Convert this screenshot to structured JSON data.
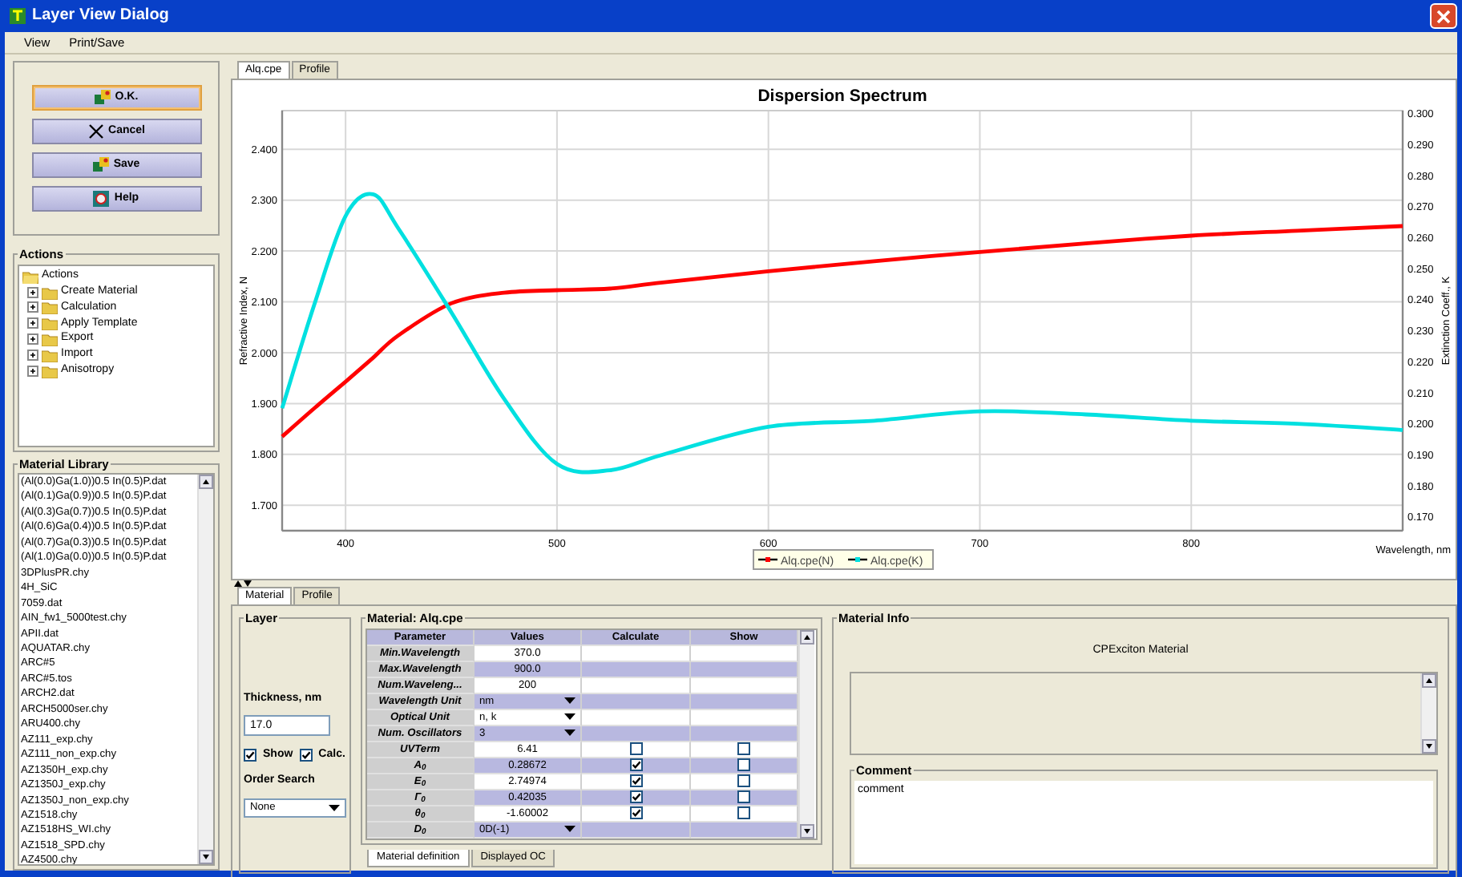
{
  "window": {
    "title": "Layer View Dialog"
  },
  "menu": [
    "View",
    "Print/Save"
  ],
  "buttons": [
    {
      "label": "O.K.",
      "kind": "ok",
      "focused": true
    },
    {
      "label": "Cancel",
      "kind": "cancel",
      "focused": false
    },
    {
      "label": "Save",
      "kind": "save",
      "focused": false
    },
    {
      "label": "Help",
      "kind": "help",
      "focused": false
    }
  ],
  "actions": {
    "title": "Actions",
    "root": "Actions",
    "items": [
      {
        "label": "Create Material",
        "expanded": false
      },
      {
        "label": "Calculation",
        "expanded": false
      },
      {
        "label": "Apply Template",
        "expanded": false
      },
      {
        "label": "Export",
        "expanded": false
      },
      {
        "label": "Import",
        "expanded": false
      },
      {
        "label": "Anisotropy",
        "expanded": false
      }
    ]
  },
  "material_library": {
    "title": "Material Library",
    "items": [
      "(Al(0.0)Ga(1.0))0.5 In(0.5)P.dat",
      "(Al(0.1)Ga(0.9))0.5 In(0.5)P.dat",
      "(Al(0.3)Ga(0.7))0.5 In(0.5)P.dat",
      "(Al(0.6)Ga(0.4))0.5 In(0.5)P.dat",
      "(Al(0.7)Ga(0.3))0.5 In(0.5)P.dat",
      "(Al(1.0)Ga(0.0))0.5 In(0.5)P.dat",
      "3DPlusPR.chy",
      "4H_SiC",
      "7059.dat",
      "AIN_fw1_5000test.chy",
      "APII.dat",
      "AQUATAR.chy",
      "ARC#5",
      "ARC#5.tos",
      "ARCH2.dat",
      "ARCH5000ser.chy",
      "ARU400.chy",
      "AZ111_exp.chy",
      "AZ111_non_exp.chy",
      "AZ1350H_exp.chy",
      "AZ1350J_exp.chy",
      "AZ1350J_non_exp.chy",
      "AZ1518.chy",
      "AZ1518HS_WI.chy",
      "AZ1518_SPD.chy",
      "AZ4500.chy"
    ]
  },
  "chart_tabs": [
    {
      "label": "Alq.cpe",
      "selected": true
    },
    {
      "label": "Profile",
      "selected": false
    }
  ],
  "chart": {
    "chart_data": {
      "type": "line",
      "title": "Dispersion Spectrum",
      "xlabel": "Wavelength, nm",
      "ylabel": "Refractive Index, N",
      "y2label": "Extinction Coeff., K",
      "x": [
        370,
        385,
        400,
        413,
        425,
        450,
        475,
        500,
        525,
        550,
        600,
        650,
        700,
        750,
        800,
        850,
        900
      ],
      "series": [
        {
          "name": "Alq.cpe(N)",
          "color": "#ff0000",
          "values": [
            1.835,
            1.89,
            1.943,
            1.99,
            2.034,
            2.097,
            2.118,
            2.123,
            2.126,
            2.138,
            2.16,
            2.18,
            2.198,
            2.215,
            2.23,
            2.24,
            2.249
          ]
        },
        {
          "name": "Alq.cpe(K)",
          "color": "#00e0e0",
          "axis": "y2",
          "values": [
            0.205,
            0.238,
            0.267,
            0.274,
            0.263,
            0.236,
            0.208,
            0.187,
            0.185,
            0.19,
            0.199,
            0.201,
            0.204,
            0.203,
            0.201,
            0.2,
            0.198
          ]
        }
      ],
      "grid": true,
      "legend": "bottom",
      "xlim": [
        370,
        900
      ],
      "ylim": [
        1.65,
        2.476
      ],
      "y2lim": [
        0.1655,
        0.301
      ],
      "xticks": [
        400,
        500,
        600,
        700,
        800
      ],
      "yticks": [
        {
          "value": 1.7,
          "label": "1.700"
        },
        {
          "value": 1.8,
          "label": "1.800"
        },
        {
          "value": 1.9,
          "label": "1.900"
        },
        {
          "value": 2.0,
          "label": "2.000"
        },
        {
          "value": 2.1,
          "label": "2.100"
        },
        {
          "value": 2.2,
          "label": "2.200"
        },
        {
          "value": 2.3,
          "label": "2.300"
        },
        {
          "value": 2.4,
          "label": "2.400"
        }
      ],
      "y2ticks": [
        {
          "value": 0.17,
          "label": "0.170"
        },
        {
          "value": 0.18,
          "label": "0.180"
        },
        {
          "value": 0.19,
          "label": "0.190"
        },
        {
          "value": 0.2,
          "label": "0.200"
        },
        {
          "value": 0.21,
          "label": "0.210"
        },
        {
          "value": 0.22,
          "label": "0.220"
        },
        {
          "value": 0.23,
          "label": "0.230"
        },
        {
          "value": 0.24,
          "label": "0.240"
        },
        {
          "value": 0.25,
          "label": "0.250"
        },
        {
          "value": 0.26,
          "label": "0.260"
        },
        {
          "value": 0.27,
          "label": "0.270"
        },
        {
          "value": 0.28,
          "label": "0.280"
        },
        {
          "value": 0.29,
          "label": "0.290"
        },
        {
          "value": 0.3,
          "label": "0.300"
        }
      ]
    }
  },
  "bottom_tabs": [
    {
      "label": "Material",
      "selected": true
    },
    {
      "label": "Profile",
      "selected": false
    }
  ],
  "layer": {
    "title": "Layer",
    "thickness_label": "Thickness, nm",
    "thickness": "17.0",
    "show": {
      "label": "Show",
      "checked": true
    },
    "calc": {
      "label": "Calc.",
      "checked": true
    },
    "order_label": "Order Search",
    "order": "None"
  },
  "material": {
    "title": "Material: Alq.cpe",
    "columns": [
      "Parameter",
      "Values",
      "Calculate",
      "Show"
    ],
    "rows": [
      {
        "kind": "value",
        "parameter": "Min.Wavelength",
        "value": "370.0"
      },
      {
        "kind": "value",
        "parameter": "Max.Wavelength",
        "value": "900.0"
      },
      {
        "kind": "value",
        "parameter": "Num.Waveleng...",
        "value": "200"
      },
      {
        "kind": "select",
        "parameter": "Wavelength Unit",
        "value": "nm"
      },
      {
        "kind": "select",
        "parameter": "Optical Unit",
        "value": "n, k"
      },
      {
        "kind": "select",
        "parameter": "Num. Oscillators",
        "value": "3"
      },
      {
        "kind": "check",
        "parameter": "UVTerm",
        "value": "6.41",
        "calculate": false,
        "show": false
      },
      {
        "kind": "check",
        "parameter": "A$_{0}$",
        "value": "0.28672",
        "calculate": true,
        "show": false
      },
      {
        "kind": "check",
        "parameter": "E$_{0}$",
        "value": "2.74974",
        "calculate": true,
        "show": false
      },
      {
        "kind": "check",
        "parameter": "Γ$_{0}$",
        "value": "0.42035",
        "calculate": true,
        "show": false
      },
      {
        "kind": "check",
        "parameter": "θ$_{0}$",
        "value": "-1.60002",
        "calculate": true,
        "show": false
      },
      {
        "kind": "select",
        "parameter": "D$_{0}$",
        "value": "0D(-1)"
      }
    ],
    "tabs": [
      {
        "label": "Material definition",
        "selected": true
      },
      {
        "label": "Displayed OC",
        "selected": false
      }
    ]
  },
  "material_info": {
    "title": "Material Info",
    "model": "CPExciton Material"
  },
  "comment": {
    "title": "Comment",
    "text": "comment"
  }
}
